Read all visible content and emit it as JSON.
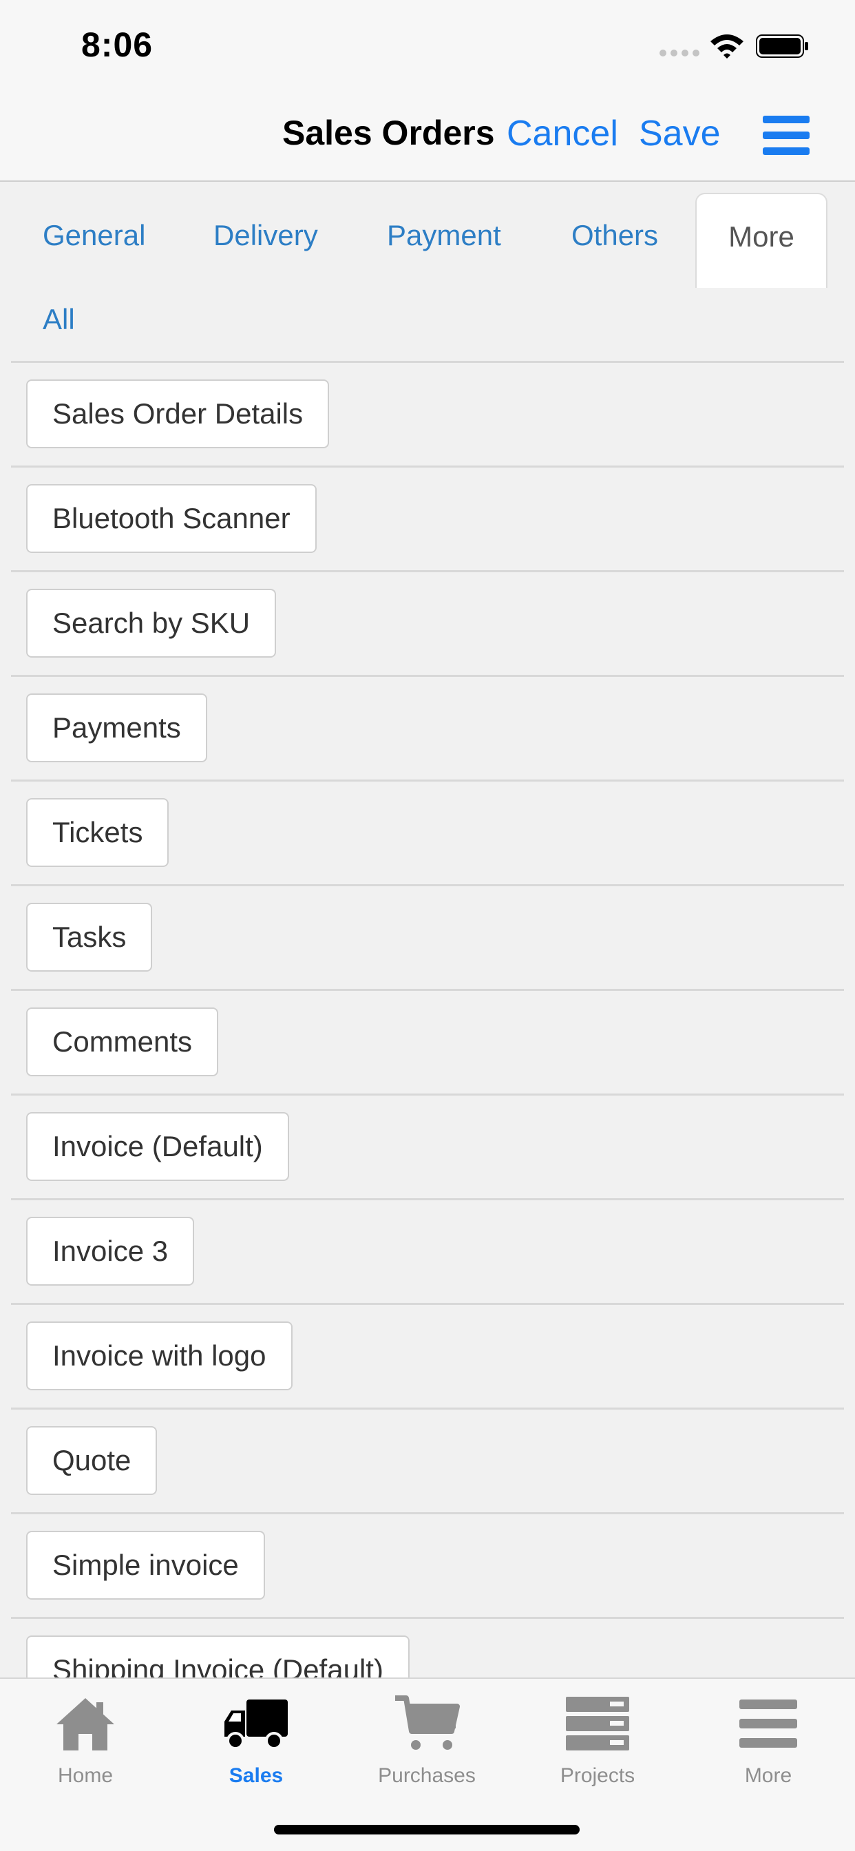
{
  "status_bar": {
    "time": "8:06"
  },
  "nav": {
    "title": "Sales Orders",
    "cancel": "Cancel",
    "save": "Save"
  },
  "tabs": {
    "general": "General",
    "delivery": "Delivery",
    "payment": "Payment",
    "others": "Others",
    "more": "More",
    "all": "All"
  },
  "list": {
    "items": [
      "Sales Order Details",
      "Bluetooth Scanner",
      "Search by SKU",
      "Payments",
      "Tickets",
      "Tasks",
      "Comments",
      "Invoice (Default)",
      "Invoice 3",
      "Invoice with logo",
      "Quote",
      "Simple invoice",
      "Shipping Invoice (Default)"
    ]
  },
  "tab_bar": {
    "home": "Home",
    "sales": "Sales",
    "purchases": "Purchases",
    "projects": "Projects",
    "more": "More"
  },
  "colors": {
    "accent": "#1a7cf0",
    "tab_link": "#2d7ec5",
    "inactive": "#8e8e8e"
  }
}
